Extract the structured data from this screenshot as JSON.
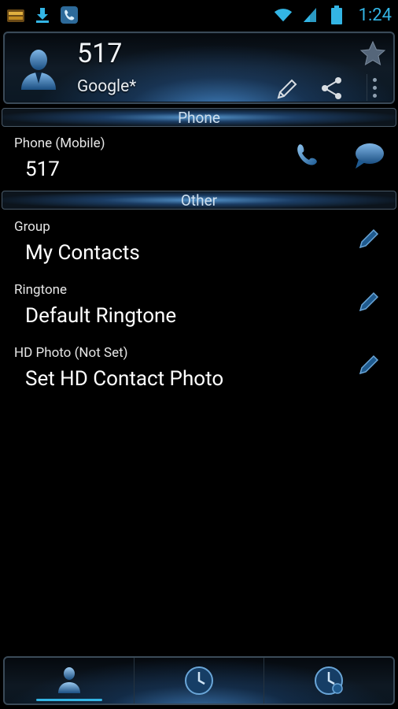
{
  "status_bar": {
    "time": "1:24",
    "icons": [
      "notification-app-icon",
      "download-icon",
      "phone-app-icon",
      "wifi-icon",
      "signal-icon",
      "battery-icon"
    ]
  },
  "contact": {
    "name": "517",
    "account": "Google*",
    "starred": false
  },
  "sections": {
    "phone": "Phone",
    "other": "Other"
  },
  "phone_entry": {
    "label": "Phone  (Mobile)",
    "value": "517"
  },
  "other_rows": [
    {
      "label": "Group",
      "value": "My Contacts"
    },
    {
      "label": "Ringtone",
      "value": "Default Ringtone"
    },
    {
      "label": "HD Photo (Not Set)",
      "value": "Set HD Contact Photo"
    }
  ],
  "bottom_tabs": [
    {
      "icon": "contacts-icon",
      "selected": true
    },
    {
      "icon": "clock-icon",
      "selected": false
    },
    {
      "icon": "clock-group-icon",
      "selected": false
    }
  ],
  "colors": {
    "accent": "#33b5e5",
    "glow": "#3c78b4",
    "background": "#000000"
  }
}
